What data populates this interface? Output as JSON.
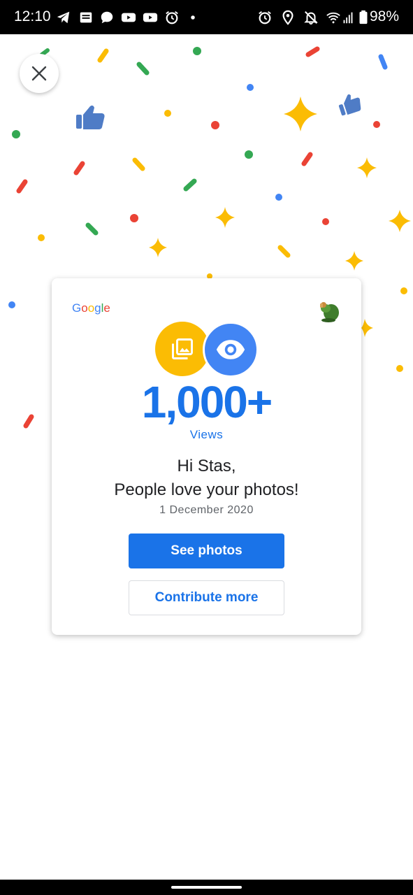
{
  "status_bar": {
    "time": "12:10",
    "battery": "98%",
    "icons": [
      "telegram-icon",
      "news-icon",
      "chat-icon",
      "youtube-icon",
      "youtube-icon",
      "alarm-icon",
      "dot-icon",
      "alarm-icon",
      "location-icon",
      "notifications-off-icon",
      "wifi-icon",
      "signal-icon",
      "battery-icon"
    ]
  },
  "close_button": {
    "icon": "close-icon"
  },
  "card": {
    "logo": "Google",
    "stat_value": "1,000+",
    "stat_label": "Views",
    "greeting_line1": "Hi Stas,",
    "greeting_line2": "People love your photos!",
    "date": "1 December 2020",
    "primary_button": "See photos",
    "secondary_button": "Contribute more"
  },
  "colors": {
    "blue": "#4285f4",
    "button_blue": "#1a73e8",
    "yellow": "#fbbc04",
    "red": "#ea4335",
    "green": "#34a853"
  }
}
